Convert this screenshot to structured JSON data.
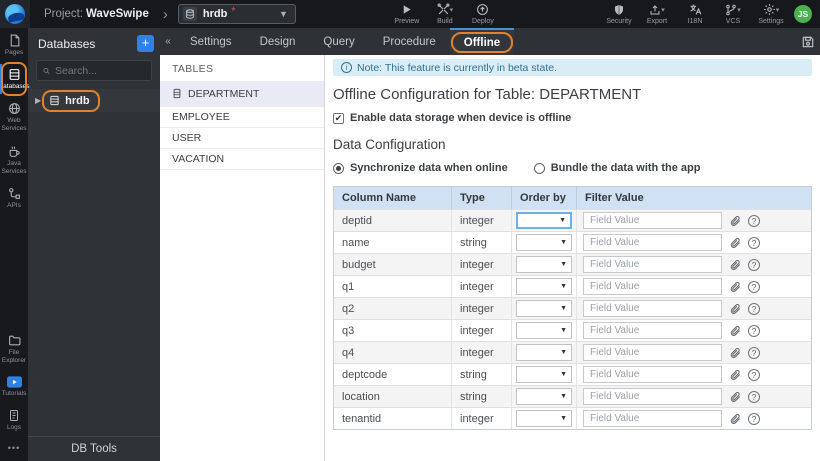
{
  "topbar": {
    "project_prefix": "Project:",
    "project_name": "WaveSwipe",
    "db_context": {
      "name": "hrdb",
      "modified_marker": "*"
    },
    "actions": [
      {
        "label": "Preview"
      },
      {
        "label": "Build",
        "has_caret": true
      },
      {
        "label": "Deploy"
      },
      {
        "label": "Security"
      },
      {
        "label": "Export",
        "has_caret": true
      },
      {
        "label": "I18N"
      },
      {
        "label": "VCS",
        "has_caret": true
      },
      {
        "label": "Settings",
        "has_caret": true
      }
    ],
    "avatar_initials": "JS"
  },
  "sidebar": {
    "items": [
      {
        "label": "Pages"
      },
      {
        "label": "Databases",
        "active": true,
        "annotated": true
      },
      {
        "label": "Web Services"
      },
      {
        "label": "Java Services"
      },
      {
        "label": "APIs"
      },
      {
        "label": "File Explorer"
      },
      {
        "label": "Tutorials"
      },
      {
        "label": "Logs"
      }
    ],
    "more_icon": "•••"
  },
  "db_panel": {
    "title": "Databases",
    "add_button": "+",
    "search_placeholder": "Search...",
    "tree": [
      {
        "label": "hrdb",
        "annotated": true
      }
    ],
    "footer": "DB Tools"
  },
  "tabs": {
    "items": [
      {
        "label": "Settings"
      },
      {
        "label": "Design"
      },
      {
        "label": "Query"
      },
      {
        "label": "Procedure"
      },
      {
        "label": "Offline",
        "active": true,
        "annotated": true
      }
    ]
  },
  "tables_panel": {
    "title": "TABLES",
    "items": [
      {
        "label": "DEPARTMENT",
        "selected": true
      },
      {
        "label": "EMPLOYEE"
      },
      {
        "label": "USER"
      },
      {
        "label": "VACATION"
      }
    ]
  },
  "content": {
    "note": "Note: This feature is currently in beta state.",
    "title": "Offline Configuration for Table: DEPARTMENT",
    "enable_checkbox": {
      "label": "Enable data storage when device is offline",
      "checked": true
    },
    "section_title": "Data Configuration",
    "radio_options": [
      {
        "label": "Synchronize data when online",
        "selected": true
      },
      {
        "label": "Bundle the data with the app",
        "selected": false
      }
    ],
    "table": {
      "headers": [
        "Column Name",
        "Type",
        "Order by",
        "Filter Value"
      ],
      "filter_placeholder": "Field Value",
      "rows": [
        {
          "name": "deptid",
          "type": "integer",
          "order_by": "",
          "filter_value": "",
          "focused": true
        },
        {
          "name": "name",
          "type": "string",
          "order_by": "",
          "filter_value": ""
        },
        {
          "name": "budget",
          "type": "integer",
          "order_by": "",
          "filter_value": ""
        },
        {
          "name": "q1",
          "type": "integer",
          "order_by": "",
          "filter_value": ""
        },
        {
          "name": "q2",
          "type": "integer",
          "order_by": "",
          "filter_value": ""
        },
        {
          "name": "q3",
          "type": "integer",
          "order_by": "",
          "filter_value": ""
        },
        {
          "name": "q4",
          "type": "integer",
          "order_by": "",
          "filter_value": ""
        },
        {
          "name": "deptcode",
          "type": "string",
          "order_by": "",
          "filter_value": ""
        },
        {
          "name": "location",
          "type": "string",
          "order_by": "",
          "filter_value": ""
        },
        {
          "name": "tenantid",
          "type": "integer",
          "order_by": "",
          "filter_value": ""
        }
      ]
    }
  },
  "colors": {
    "annotation_orange": "#e0832f",
    "accent_blue": "#2f80e7",
    "active_tab_indicator": "#4a90d9",
    "note_bg": "#d9edf7",
    "note_text": "#31708f",
    "table_header_bg": "#cfe1f2",
    "selected_table_row_bg": "#e8eaf6",
    "avatar_green": "#4caf50",
    "topbar_bg": "#16181c"
  }
}
